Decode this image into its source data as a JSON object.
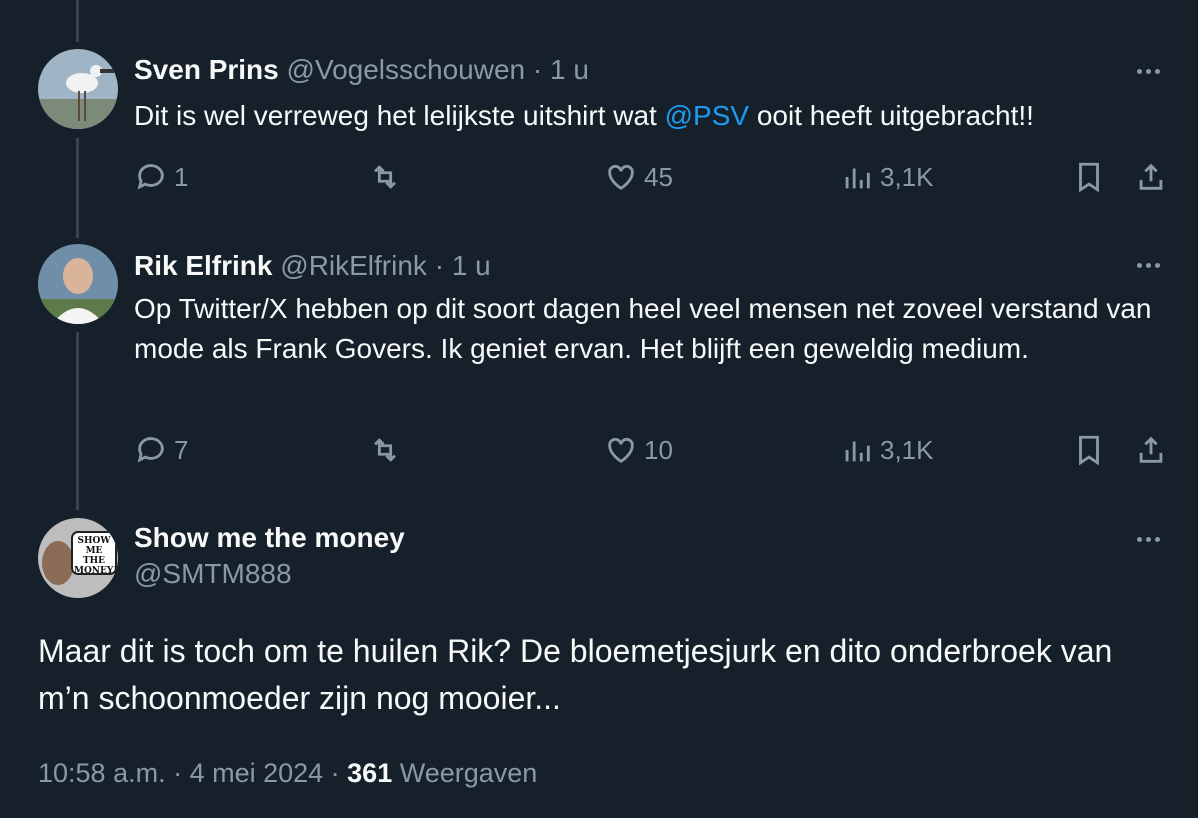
{
  "tweets": [
    {
      "name": "Sven Prins",
      "handle": "@Vogelsschouwen",
      "time": "· 1 u",
      "text_before": "Dit is wel verreweg het lelijkste uitshirt wat ",
      "mention": "@PSV",
      "text_after": " ooit heeft uitgebracht!!",
      "replies": "1",
      "reposts": "",
      "likes": "45",
      "views": "3,1K"
    },
    {
      "name": "Rik Elfrink",
      "handle": "@RikElfrink",
      "time": "· 1 u",
      "text": "Op Twitter/X hebben op dit soort dagen heel veel mensen net zoveel verstand van mode als Frank Govers. Ik geniet ervan. Het blijft een geweldig medium.",
      "replies": "7",
      "reposts": "",
      "likes": "10",
      "views": "3,1K"
    }
  ],
  "main_tweet": {
    "name": "Show me the money",
    "handle": "@SMTM888",
    "avatar_sign_text": "SHOW ME THE MONEY!",
    "text": "Maar dit is toch om te huilen Rik? De bloemetjesjurk en dito onderbroek van m’n schoonmoeder zijn nog mooier...",
    "timestamp": "10:58 a.m. · 4 mei 2024 · ",
    "view_count": "361",
    "views_label": " Weergaven"
  },
  "colors": {
    "background": "#15202b",
    "text": "#f7f9f9",
    "muted": "#8b98a5",
    "link": "#1d9bf0",
    "thread_line": "#38444d"
  }
}
